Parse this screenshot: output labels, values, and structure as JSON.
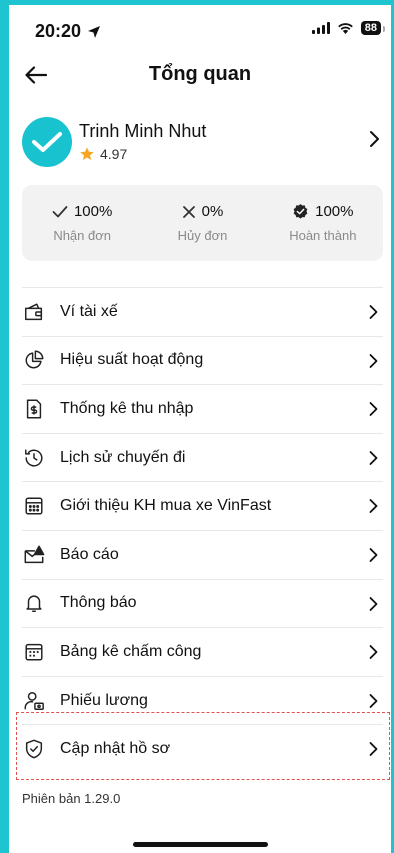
{
  "status_bar": {
    "time": "20:20",
    "battery": "88"
  },
  "header": {
    "title": "Tổng quan"
  },
  "profile": {
    "name": "Trinh Minh Nhut",
    "rating": "4.97"
  },
  "stats": [
    {
      "value": "100%",
      "label": "Nhận đơn",
      "icon": "check-icon"
    },
    {
      "value": "0%",
      "label": "Hủy đơn",
      "icon": "x-icon"
    },
    {
      "value": "100%",
      "label": "Hoàn thành",
      "icon": "badge-check-icon"
    }
  ],
  "menu": [
    {
      "label": "Ví tài xế",
      "icon": "wallet-icon"
    },
    {
      "label": "Hiệu suất hoạt động",
      "icon": "pie-chart-icon"
    },
    {
      "label": "Thống kê thu nhập",
      "icon": "income-doc-icon"
    },
    {
      "label": "Lịch sử chuyến đi",
      "icon": "history-icon"
    },
    {
      "label": "Giới thiệu KH mua xe VinFast",
      "icon": "calculator-icon"
    },
    {
      "label": "Báo cáo",
      "icon": "report-mail-icon"
    },
    {
      "label": "Thông báo",
      "icon": "bell-icon"
    },
    {
      "label": "Bảng kê chấm công",
      "icon": "timesheet-icon"
    },
    {
      "label": "Phiếu lương",
      "icon": "payslip-icon"
    },
    {
      "label": "Cập nhật hồ sơ",
      "icon": "shield-check-icon"
    }
  ],
  "version": "Phiên bản 1.29.0",
  "colors": {
    "accent": "#1fc4d1",
    "star": "#f5a623",
    "highlight": "#e05252"
  }
}
